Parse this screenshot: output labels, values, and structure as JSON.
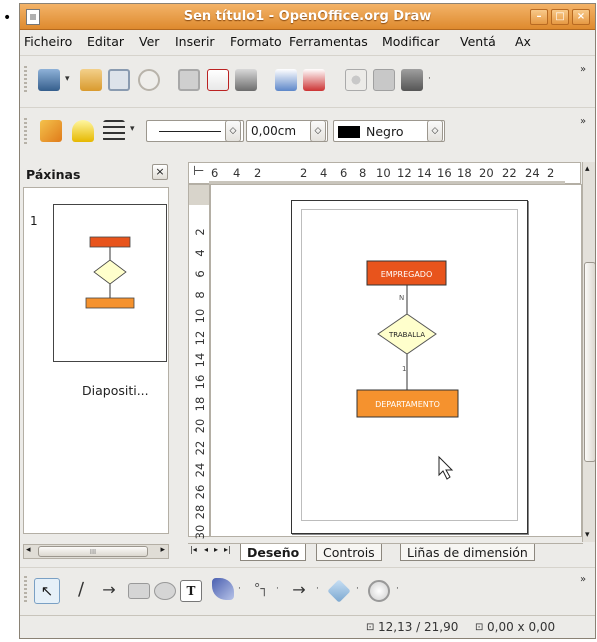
{
  "bullet": "•",
  "window": {
    "title": "Sen título1 - OpenOffice.org Draw",
    "minimize": "–",
    "maximize": "□",
    "close": "×"
  },
  "menu": [
    "Ficheiro",
    "Editar",
    "Ver",
    "Inserir",
    "Formato",
    "Ferramentas",
    "Modificar",
    "Ventá",
    "Ax"
  ],
  "line_toolbar": {
    "width_value": "0,00cm",
    "color_name": "Negro"
  },
  "pages_panel": {
    "title": "Páxinas",
    "close": "×",
    "page_number": "1",
    "page_label": "Diapositi...",
    "scroll_thumb": "III"
  },
  "ruler_h": [
    "6",
    "4",
    "2",
    "2",
    "4",
    "6",
    "8",
    "10",
    "12",
    "14",
    "16",
    "18",
    "20",
    "22",
    "24",
    "2"
  ],
  "ruler_v": [
    "2",
    "4",
    "6",
    "8",
    "10",
    "12",
    "14",
    "16",
    "18",
    "20",
    "22",
    "24",
    "26",
    "28",
    "30"
  ],
  "diagram": {
    "entity_top": "EMPREGADO",
    "relationship": "TRABALLA",
    "entity_bottom": "DEPARTAMENTO",
    "card_top": "N",
    "card_bottom": "1",
    "colors": {
      "entity_top": "#e8541c",
      "entity_bottom": "#f5922e",
      "relationship_fill": "#ffffcc"
    }
  },
  "tabs": {
    "nav": [
      "|◂",
      "◂",
      "▸",
      "▸|"
    ],
    "items": [
      "Deseño",
      "Controis",
      "Liñas de dimensión"
    ]
  },
  "status": {
    "position": "12,13 / 21,90",
    "size": "0,00 x 0,00"
  },
  "icons": {
    "toolbar1": [
      "new-document-icon",
      "open-folder-icon",
      "save-icon",
      "email-icon",
      "edit-file-icon",
      "export-pdf-icon",
      "print-icon",
      "spellcheck-icon",
      "auto-spellcheck-icon",
      "cut-icon",
      "copy-icon",
      "paste-icon"
    ],
    "toolbar2": [
      "line-style-icon",
      "area-fill-icon",
      "arrow-style-icon"
    ],
    "drawing": [
      "select-icon",
      "line-icon",
      "arrow-line-icon",
      "rectangle-icon",
      "ellipse-icon",
      "text-icon",
      "curve-icon",
      "connector-icon",
      "lines-arrows-icon",
      "basic-shapes-icon",
      "symbol-shapes-icon"
    ]
  }
}
